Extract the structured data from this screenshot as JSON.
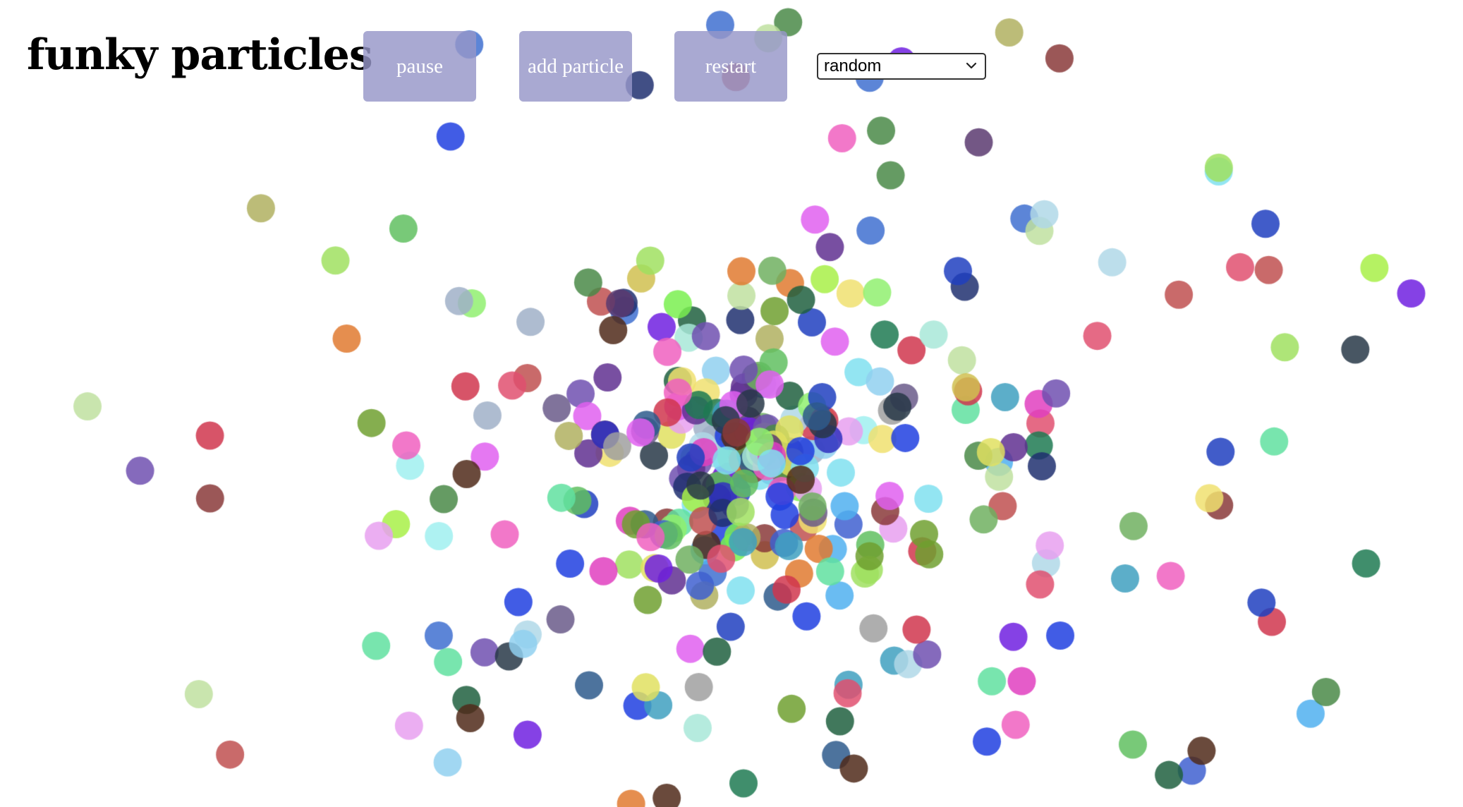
{
  "app": {
    "title": "funky particles"
  },
  "controls": {
    "pause_label": "pause",
    "add_particle_label": "add particle",
    "restart_label": "restart",
    "mode_select": {
      "selected": "random",
      "icon": "chevron-down-icon"
    }
  },
  "colors": {
    "button_background": "#9696c8",
    "button_text": "#ffffff",
    "background": "#ffffff"
  },
  "particles": {
    "shape": "circle",
    "palette": [
      "#d0364d",
      "#2e5a8c",
      "#1e7a52",
      "#8a3a3a",
      "#a8e8d8",
      "#e8a0f0",
      "#502a1a",
      "#7af050",
      "#e0e060",
      "#90f070",
      "#4060d0",
      "#4a8a48",
      "#e040c0",
      "#283848",
      "#a8f048",
      "#5a3a70",
      "#50b0f0",
      "#70b060",
      "#b0b060",
      "#e07a30",
      "#a0e060",
      "#2040e0",
      "#a0a0a0",
      "#c05050",
      "#60e0a0",
      "#80e0f0",
      "#40a0c0",
      "#7020e0",
      "#a0b0c8",
      "#6a5a8a",
      "#3030c0",
      "#e060f0",
      "#2040c0",
      "#e05070",
      "#a0f0f0",
      "#f0e070",
      "#203070",
      "#603090",
      "#90d0f0",
      "#c0e0a0",
      "#7050b0",
      "#206040",
      "#d0c050",
      "#f060c0",
      "#60c060",
      "#4070d0",
      "#70a030",
      "#b0d8e8"
    ]
  }
}
